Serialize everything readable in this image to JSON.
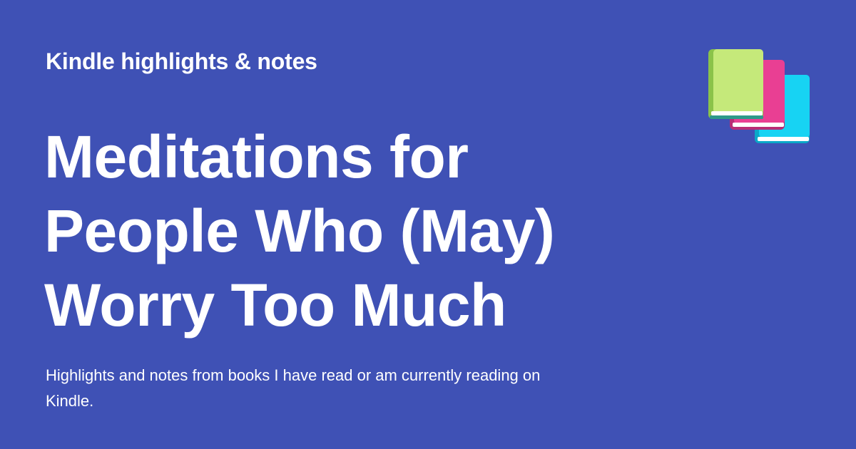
{
  "card": {
    "site_label": "Kindle highlights & notes",
    "title_lines": [
      "Meditations for",
      "People Who (May)",
      "Worry Too Much"
    ],
    "description": "Highlights and notes from books I have read or am currently reading on Kindle.",
    "icon": "books-icon"
  },
  "colors": {
    "background": "#3f51b5",
    "text": "#ffffff",
    "book_green": "#c5e97a",
    "book_pink": "#e93f93",
    "book_cyan": "#17d3f3"
  }
}
